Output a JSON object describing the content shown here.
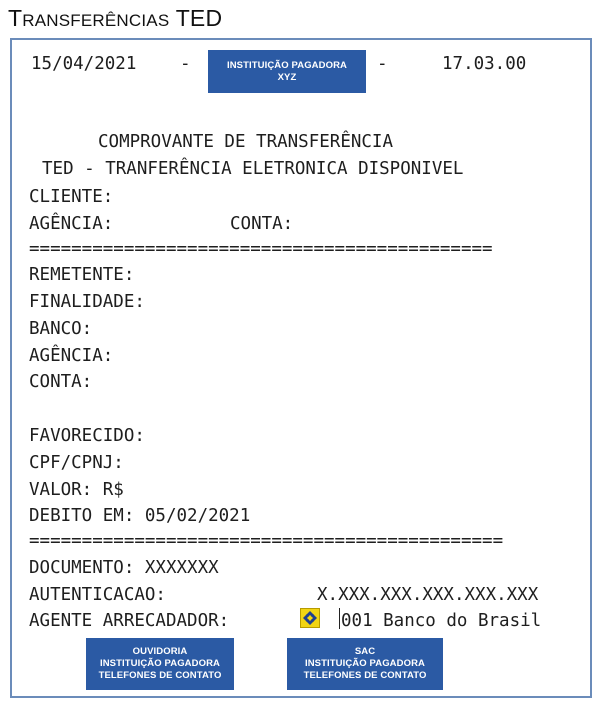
{
  "page_title": {
    "first_letter": "T",
    "rest": "RANSFERÊNCIAS",
    "suffix": "TED"
  },
  "header": {
    "date": "15/04/2021",
    "dash_left": "-",
    "dash_right": "-",
    "time": "17.03.00"
  },
  "payer_badge": {
    "line1": "INSTITUIÇÃO PAGADORA",
    "line2": "XYZ"
  },
  "receipt": {
    "title": "COMPROVANTE DE TRANSFERÊNCIA",
    "subtitle": "TED - TRANFERÊNCIA ELETRONICA DISPONIVEL",
    "cliente": "CLIENTE:",
    "agencia": "AGÊNCIA:",
    "conta": "CONTA:",
    "separator1": "============================================",
    "remetente": "REMETENTE:",
    "finalidade": "FINALIDADE:",
    "banco": "BANCO:",
    "agencia2": "AGÊNCIA:",
    "conta2": "CONTA:",
    "favorecido": "FAVORECIDO:",
    "cpf": "CPF/CPNJ:",
    "valor": "VALOR: R$",
    "debito": "DEBITO EM: 05/02/2021",
    "separator2": "=============================================",
    "documento": "DOCUMENTO: XXXXXXX",
    "autenticacao_label": "AUTENTICACAO:",
    "autenticacao_value": "X.XXX.XXX.XXX.XXX.XXX",
    "agente_label": "AGENTE ARRECADADOR:",
    "agente_value": "001 Banco do Brasil"
  },
  "footer_buttons": [
    {
      "line1": "OUVIDORIA",
      "line2": "INSTITUIÇÃO PAGADORA",
      "line3": "TELEFONES DE CONTATO"
    },
    {
      "line1": "SAC",
      "line2": "INSTITUIÇÃO PAGADORA",
      "line3": "TELEFONES DE CONTATO"
    }
  ],
  "colors": {
    "badge_blue": "#2b5aa4",
    "frame_border": "#6b8cba",
    "bb_yellow": "#f2d413"
  },
  "icons": {
    "bank_logo": "banco-do-brasil-logo-icon"
  }
}
